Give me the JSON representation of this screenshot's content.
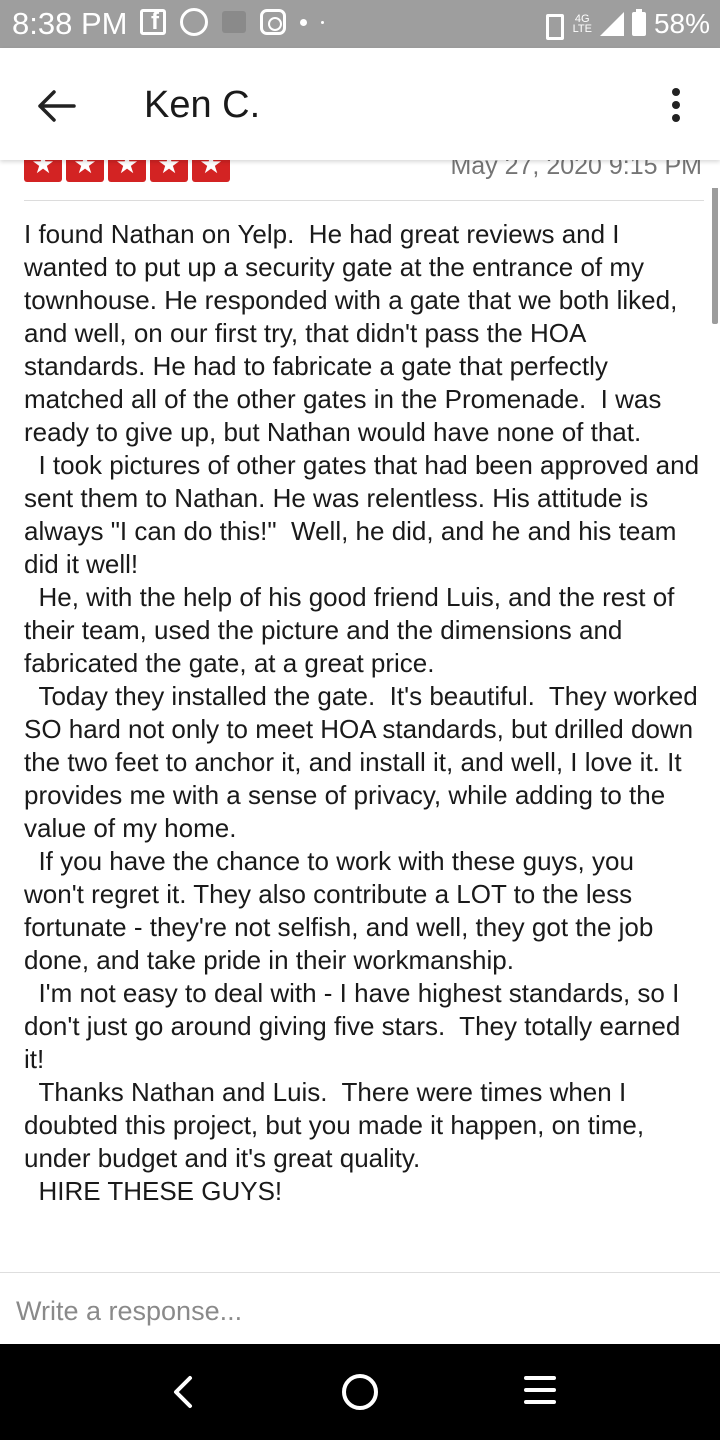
{
  "status_bar": {
    "time": "8:38 PM",
    "network": "4G",
    "network_sub": "LTE",
    "battery": "58%",
    "icons": [
      "facebook-icon",
      "whatsapp-icon",
      "gallery-icon",
      "instagram-icon",
      "dot-icon",
      "vibrate-icon",
      "signal-icon",
      "battery-icon"
    ]
  },
  "app_bar": {
    "title": "Ken C.",
    "back_icon": "arrow-left-icon",
    "menu_icon": "more-vertical-icon"
  },
  "review": {
    "rating": 5,
    "max_rating": 5,
    "star_color": "#d32323",
    "date": "May 27, 2020 9:15 PM",
    "paragraphs": [
      "I found Nathan on Yelp.  He had great reviews and I wanted to put up a security gate at the entrance of my townhouse. He responded with a gate that we both liked, and well, on our first try, that didn't pass the HOA standards. He had to fabricate a gate that perfectly matched all of the other gates in the Promenade.  I was ready to give up, but Nathan would have none of that.",
      "  I took pictures of other gates that had been approved and sent them to Nathan. He was relentless. His attitude is always \"I can do this!\"  Well, he did, and he and his team did it well!",
      "  He, with the help of his good friend Luis, and the rest of their team, used the picture and the dimensions and fabricated the gate, at a great price.",
      "  Today they installed the gate.  It's beautiful.  They worked SO hard not only to meet HOA standards, but drilled down the two feet to anchor it, and install it, and well, I love it. It provides me with a sense of privacy, while adding to the value of my home.",
      "  If you have the chance to work with these guys, you won't regret it. They also contribute a LOT to the less fortunate - they're not selfish, and well, they got the job done, and take pride in their workmanship.",
      "  I'm not easy to deal with - I have highest standards, so I don't just go around giving five stars.  They totally earned it!",
      "  Thanks Nathan and Luis.  There were times when I doubted this project, but you made it happen, on time, under budget and it's great quality.",
      "  HIRE THESE GUYS!"
    ]
  },
  "response": {
    "placeholder": "Write a response..."
  },
  "nav_bar": {
    "icons": [
      "back-chevron-icon",
      "home-circle-icon",
      "menu-lines-icon"
    ]
  }
}
